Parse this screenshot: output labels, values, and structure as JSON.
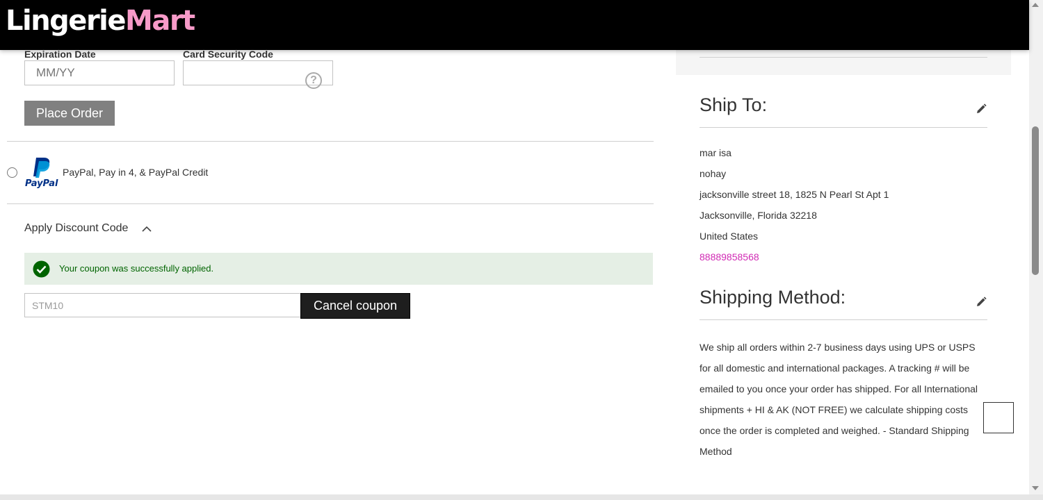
{
  "brand": {
    "part1": "Lingerie",
    "part2": "Mart"
  },
  "payment": {
    "expiration_label": "Expiration Date",
    "expiration_placeholder": "MM/YY",
    "security_label": "Card Security Code",
    "help_glyph": "?",
    "place_order_label": "Place Order",
    "paypal_option_label": "PayPal, Pay in 4, & PayPal Credit",
    "paypal_logo_text": "PayPal"
  },
  "discount": {
    "title": "Apply Discount Code",
    "success_message": "Your coupon was successfully applied.",
    "coupon_value": "STM10",
    "cancel_label": "Cancel coupon"
  },
  "ship_to": {
    "heading": "Ship To:",
    "name": "mar isa",
    "company": "nohay",
    "street": "jacksonville street 18, 1825 N Pearl St Apt 1",
    "city_line": "Jacksonville, Florida 32218",
    "country": "United States",
    "phone": "88889858568"
  },
  "shipping_method": {
    "heading": "Shipping Method:",
    "description": "We ship all orders within 2-7 business days using UPS or USPS for all domestic and international packages. A tracking # will be emailed to you once your order has shipped. For all International shipments + HI & AK (NOT FREE) we calculate shipping costs once the order is completed and weighed. - Standard Shipping Method"
  },
  "colors": {
    "header_bg": "#000000",
    "brand_accent": "#f79ac8",
    "success_bg": "#e5efe5",
    "success_text": "#006400",
    "phone_link": "#d12ab4",
    "button_dark": "#1e1e1e",
    "button_gray": "#808080"
  },
  "icons": [
    "help-icon",
    "paypal-logo",
    "chevron-up-icon",
    "check-circle-icon",
    "pencil-icon"
  ]
}
